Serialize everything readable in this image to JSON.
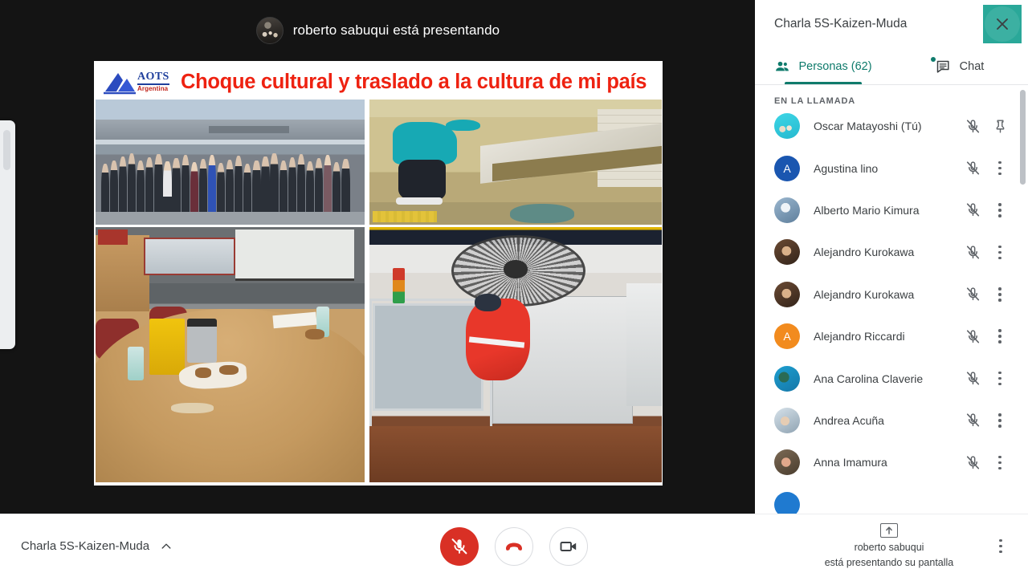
{
  "topbar": {
    "presenting_text": "roberto sabuqui está presentando",
    "avatar_icon": "presenter-avatar"
  },
  "slide": {
    "logo": {
      "word": "AOTS",
      "sub": "Argentina",
      "icon": "aots-logo-mark"
    },
    "title": "Choque cultural y traslado a la cultura de mi país",
    "photos": [
      {
        "caption": "group-photo-outside-training-center"
      },
      {
        "caption": "worker-cleaning-station-counter"
      },
      {
        "caption": "messy-meeting-room-table"
      },
      {
        "caption": "industrial-machine-with-red-jacket"
      }
    ]
  },
  "panel": {
    "title": "Charla 5S-Kaizen-Muda",
    "close_icon": "close-icon",
    "tabs": [
      {
        "label": "Personas (62)",
        "icon": "people-icon",
        "active": true,
        "has_dot": false
      },
      {
        "label": "Chat",
        "icon": "chat-icon",
        "active": false,
        "has_dot": true
      }
    ],
    "section_label": "EN LA LLAMADA",
    "people": [
      {
        "name": "Oscar Matayoshi (Tú)",
        "avatar_type": "photo",
        "avatar_color": "#3dd6e6",
        "initial": "",
        "mic_icon": "mic-off-icon",
        "action_icon": "pin-icon"
      },
      {
        "name": "Agustina lino",
        "avatar_type": "initial",
        "avatar_color": "#1a56b0",
        "initial": "A",
        "mic_icon": "mic-off-icon",
        "action_icon": "more-options-icon"
      },
      {
        "name": "Alberto Mario Kimura",
        "avatar_type": "photo",
        "avatar_color": "#9bb7cf",
        "initial": "",
        "mic_icon": "mic-off-icon",
        "action_icon": "more-options-icon"
      },
      {
        "name": "Alejandro Kurokawa",
        "avatar_type": "photo",
        "avatar_color": "#6b4a33",
        "initial": "",
        "mic_icon": "mic-off-icon",
        "action_icon": "more-options-icon"
      },
      {
        "name": "Alejandro Kurokawa",
        "avatar_type": "photo",
        "avatar_color": "#6b4a33",
        "initial": "",
        "mic_icon": "mic-off-icon",
        "action_icon": "more-options-icon"
      },
      {
        "name": "Alejandro Riccardi",
        "avatar_type": "initial",
        "avatar_color": "#f28b1e",
        "initial": "A",
        "mic_icon": "mic-off-icon",
        "action_icon": "more-options-icon"
      },
      {
        "name": "Ana Carolina Claverie",
        "avatar_type": "photo",
        "avatar_color": "#1d9fd0",
        "initial": "",
        "mic_icon": "mic-off-icon",
        "action_icon": "more-options-icon"
      },
      {
        "name": "Andrea Acuña",
        "avatar_type": "photo",
        "avatar_color": "#b8c6cf",
        "initial": "",
        "mic_icon": "mic-off-icon",
        "action_icon": "more-options-icon"
      },
      {
        "name": "Anna Imamura",
        "avatar_type": "photo",
        "avatar_color": "#7c6a55",
        "initial": "",
        "mic_icon": "mic-off-icon",
        "action_icon": "more-options-icon"
      }
    ]
  },
  "bottom": {
    "meeting_name": "Charla 5S-Kaizen-Muda",
    "chevron_icon": "chevron-up-icon",
    "controls": [
      {
        "name": "mic-off-button",
        "icon": "mic-off-icon"
      },
      {
        "name": "hangup-button",
        "icon": "hangup-icon"
      },
      {
        "name": "camera-button",
        "icon": "camera-icon"
      }
    ],
    "present_status_line1": "roberto sabuqui",
    "present_status_line2": "está presentando su pantalla",
    "present_icon": "present-screen-icon",
    "more_options_icon": "more-options-icon"
  },
  "colors": {
    "accent_teal": "#0f7b6c",
    "close_bg": "#2aa899",
    "mic_off_red": "#d93025",
    "hangup_red": "#d93025",
    "slide_title_red": "#ee2211",
    "stage_bg": "#141414"
  }
}
